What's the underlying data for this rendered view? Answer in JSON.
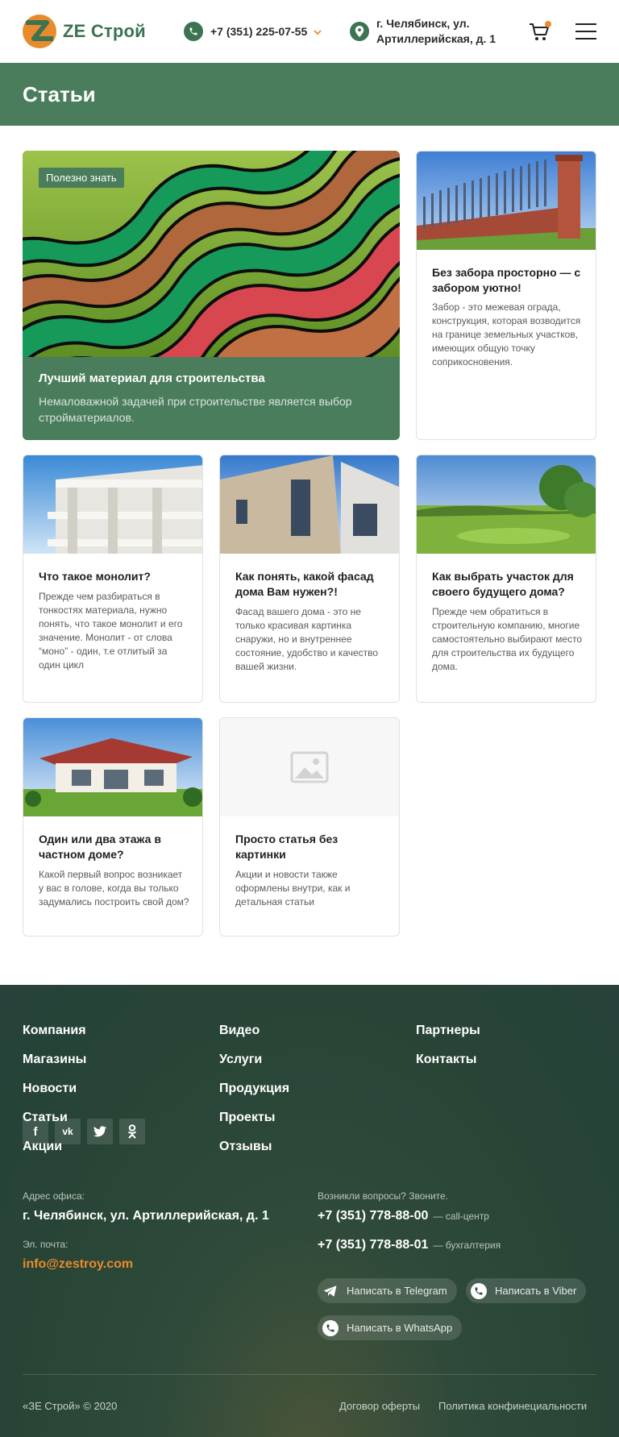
{
  "header": {
    "logo_text": "ZE Строй",
    "phone": "+7 (351) 225-07-55",
    "address_line1": "г. Челябинск, ул.",
    "address_line2": "Артиллерийская, д. 1"
  },
  "page": {
    "title": "Статьи"
  },
  "featured": {
    "tag": "Полезно знать",
    "title": "Лучший материал для строительства",
    "description": "Немаловажной задачей при строительстве является выбор стройматериалов."
  },
  "articles": [
    {
      "title": "Без забора просторно — с забором уютно!",
      "description": "Забор - это межевая ограда, конструкция, которая возводится на границе земельных участков, имеющих общую точку соприкосновения."
    },
    {
      "title": "Что такое монолит?",
      "description": "Прежде чем разбираться в тонкостях материала, нужно понять, что такое монолит и его значение. Монолит - от слова “моно” - один, т.е отлитый за один цикл"
    },
    {
      "title": "Как понять, какой фасад дома Вам нужен?!",
      "description": "Фасад вашего дома - это не только красивая картинка снаружи, но и внутреннее состояние, удобство и качество вашей жизни."
    },
    {
      "title": "Как выбрать участок для своего будущего дома?",
      "description": "Прежде чем обратиться в строительную компанию, многие самостоятельно выбирают место для строительства их будущего дома."
    },
    {
      "title": "Один или два этажа в частном доме?",
      "description": "Какой первый вопрос возникает у вас в голове,  когда вы только задумались построить свой дом?"
    },
    {
      "title": "Просто статья без картинки",
      "description": "Акции и новости также оформлены внутри, как и детальная статьи"
    }
  ],
  "footer": {
    "nav_col1": [
      "Компания",
      "Магазины",
      "Новости",
      "Статьи",
      "Акции"
    ],
    "nav_col2": [
      "Видео",
      "Услуги",
      "Продукция",
      "Проекты",
      "Отзывы"
    ],
    "nav_col3": [
      "Партнеры",
      "Контакты"
    ],
    "office_label": "Адрес офиса:",
    "office_address": "г. Челябинск, ул. Артиллерийская, д. 1",
    "email_label": "Эл. почта:",
    "email": "info@zestroy.com",
    "questions_label": "Возникли вопросы? Звоните.",
    "phone1": "+7 (351) 778-88-00",
    "phone1_note": "— call-центр",
    "phone2": "+7 (351) 778-88-01",
    "phone2_note": "— бухгалтерия",
    "telegram": "Написать в Telegram",
    "viber": "Написать в Viber",
    "whatsapp": "Написать в WhatsApp",
    "copyright": "«ЗЕ Строй» © 2020",
    "offer": "Договор оферты",
    "privacy": "Политика конфинециальности"
  },
  "colors": {
    "brand_green": "#4a7d5c",
    "accent_orange": "#e98a2c",
    "footer_bg": "#274436"
  }
}
